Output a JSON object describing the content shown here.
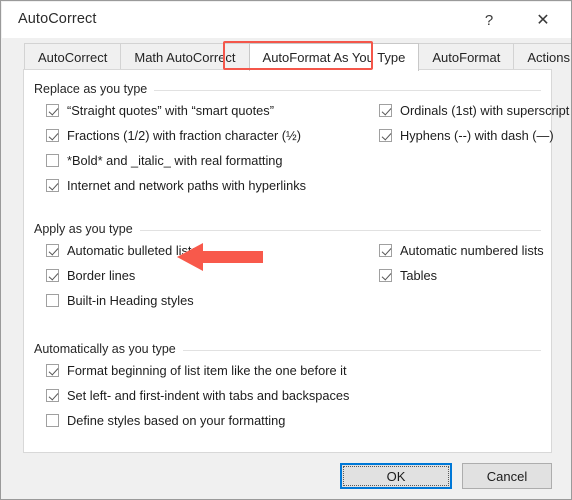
{
  "window": {
    "title": "AutoCorrect",
    "help_icon": "?",
    "close_icon": "✕"
  },
  "tabs": [
    {
      "label": "AutoCorrect",
      "active": false
    },
    {
      "label": "Math AutoCorrect",
      "active": false
    },
    {
      "label": "AutoFormat As You Type",
      "active": true
    },
    {
      "label": "AutoFormat",
      "active": false
    },
    {
      "label": "Actions",
      "active": false
    }
  ],
  "groups": [
    {
      "label": "Replace as you type",
      "left_items": [
        {
          "label": "“Straight quotes” with “smart quotes”",
          "checked": true
        },
        {
          "label": "Fractions (1/2) with fraction character (½)",
          "checked": true
        },
        {
          "label": "*Bold* and _italic_ with real formatting",
          "checked": false
        },
        {
          "label": "Internet and network paths with hyperlinks",
          "checked": true
        }
      ],
      "right_items": [
        {
          "label": "Ordinals (1st) with superscript",
          "checked": true
        },
        {
          "label": "Hyphens (--) with dash (—)",
          "checked": true
        }
      ]
    },
    {
      "label": "Apply as you type",
      "left_items": [
        {
          "label": "Automatic bulleted lists",
          "checked": true
        },
        {
          "label": "Border lines",
          "checked": true
        },
        {
          "label": "Built-in Heading styles",
          "checked": false
        }
      ],
      "right_items": [
        {
          "label": "Automatic numbered lists",
          "checked": true
        },
        {
          "label": "Tables",
          "checked": true
        }
      ]
    },
    {
      "label": "Automatically as you type",
      "left_items": [
        {
          "label": "Format beginning of list item like the one before it",
          "checked": true
        },
        {
          "label": "Set left- and first-indent with tabs and backspaces",
          "checked": true
        },
        {
          "label": "Define styles based on your formatting",
          "checked": false
        }
      ],
      "right_items": []
    }
  ],
  "buttons": {
    "ok_label": "OK",
    "cancel_label": "Cancel"
  },
  "annotations": {
    "tab_highlight_color": "#f4564a",
    "arrow_color": "#f8594b",
    "arrow_points_to": "Automatic bulleted lists",
    "tab_highlighted": "AutoFormat As You Type"
  }
}
